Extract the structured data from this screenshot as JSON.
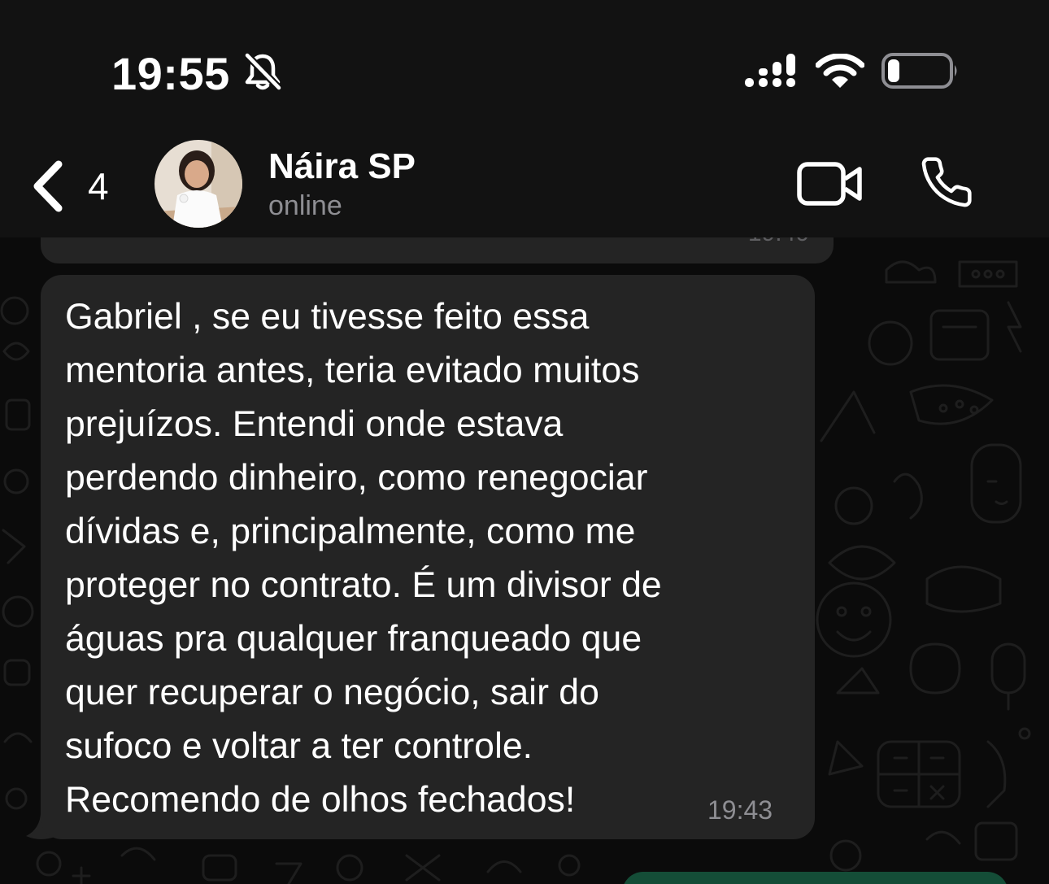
{
  "status_bar": {
    "time": "19:55",
    "silent_icon": "bell-slash-icon",
    "signal_icon": "signal-icon",
    "wifi_icon": "wifi-icon",
    "battery_icon": "battery-icon",
    "battery_level": 0.2
  },
  "header": {
    "back_icon": "chevron-left-icon",
    "back_count": "4",
    "contact_name": "Náira SP",
    "contact_status": "online",
    "video_icon": "video-camera-icon",
    "call_icon": "phone-icon"
  },
  "chat": {
    "messages": [
      {
        "direction": "incoming",
        "text": "Gabriel , se eu tivesse feito essa\nmentoria antes, teria evitado muitos\nprejuízos. Entendi onde estava\nperdendo dinheiro, como renegociar\ndívidas e, principalmente, como me\nproteger no contrato. É um divisor de\náguas pra qualquer franqueado que\nquer recuperar o negócio, sair do\nsufoco e voltar a ter controle.\nRecomendo de olhos fechados!",
        "time": "19:43"
      }
    ]
  },
  "colors": {
    "background": "#0b0b0b",
    "header_bg": "#121212",
    "incoming_bubble": "#242424",
    "outgoing_bubble": "#144d37",
    "text": "#ffffff",
    "secondary_text": "#8e8e93"
  }
}
